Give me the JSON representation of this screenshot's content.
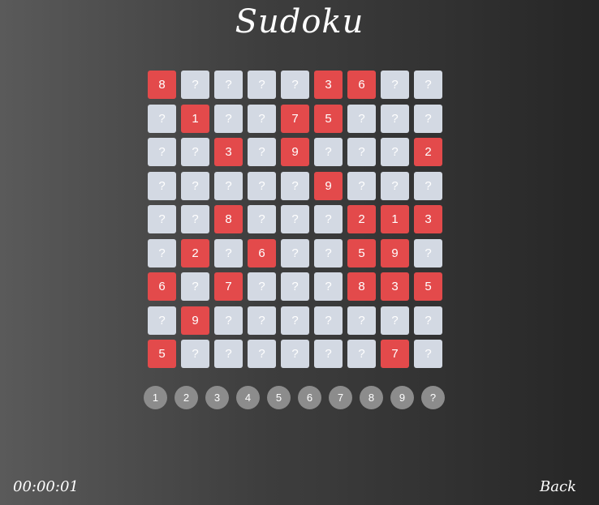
{
  "title": "Sudoku",
  "colors": {
    "given": "#e34a4b",
    "empty": "#d3d9e3",
    "picker": "#8c8c8c"
  },
  "empty_symbol": "?",
  "board": [
    [
      "8",
      "",
      "",
      "",
      "",
      "3",
      "6",
      "",
      ""
    ],
    [
      "",
      "1",
      "",
      "",
      "7",
      "5",
      "",
      "",
      ""
    ],
    [
      "",
      "",
      "3",
      "",
      "9",
      "",
      "",
      "",
      "2"
    ],
    [
      "",
      "",
      "",
      "",
      "",
      "9",
      "",
      "",
      ""
    ],
    [
      "",
      "",
      "8",
      "",
      "",
      "",
      "2",
      "1",
      "3"
    ],
    [
      "",
      "2",
      "",
      "6",
      "",
      "",
      "5",
      "9",
      ""
    ],
    [
      "6",
      "",
      "7",
      "",
      "",
      "",
      "8",
      "3",
      "5"
    ],
    [
      "",
      "9",
      "",
      "",
      "",
      "",
      "",
      "",
      ""
    ],
    [
      "5",
      "",
      "",
      "",
      "",
      "",
      "",
      "7",
      ""
    ]
  ],
  "picker": [
    "1",
    "2",
    "3",
    "4",
    "5",
    "6",
    "7",
    "8",
    "9",
    "?"
  ],
  "timer": "00:00:01",
  "back_label": "Back"
}
